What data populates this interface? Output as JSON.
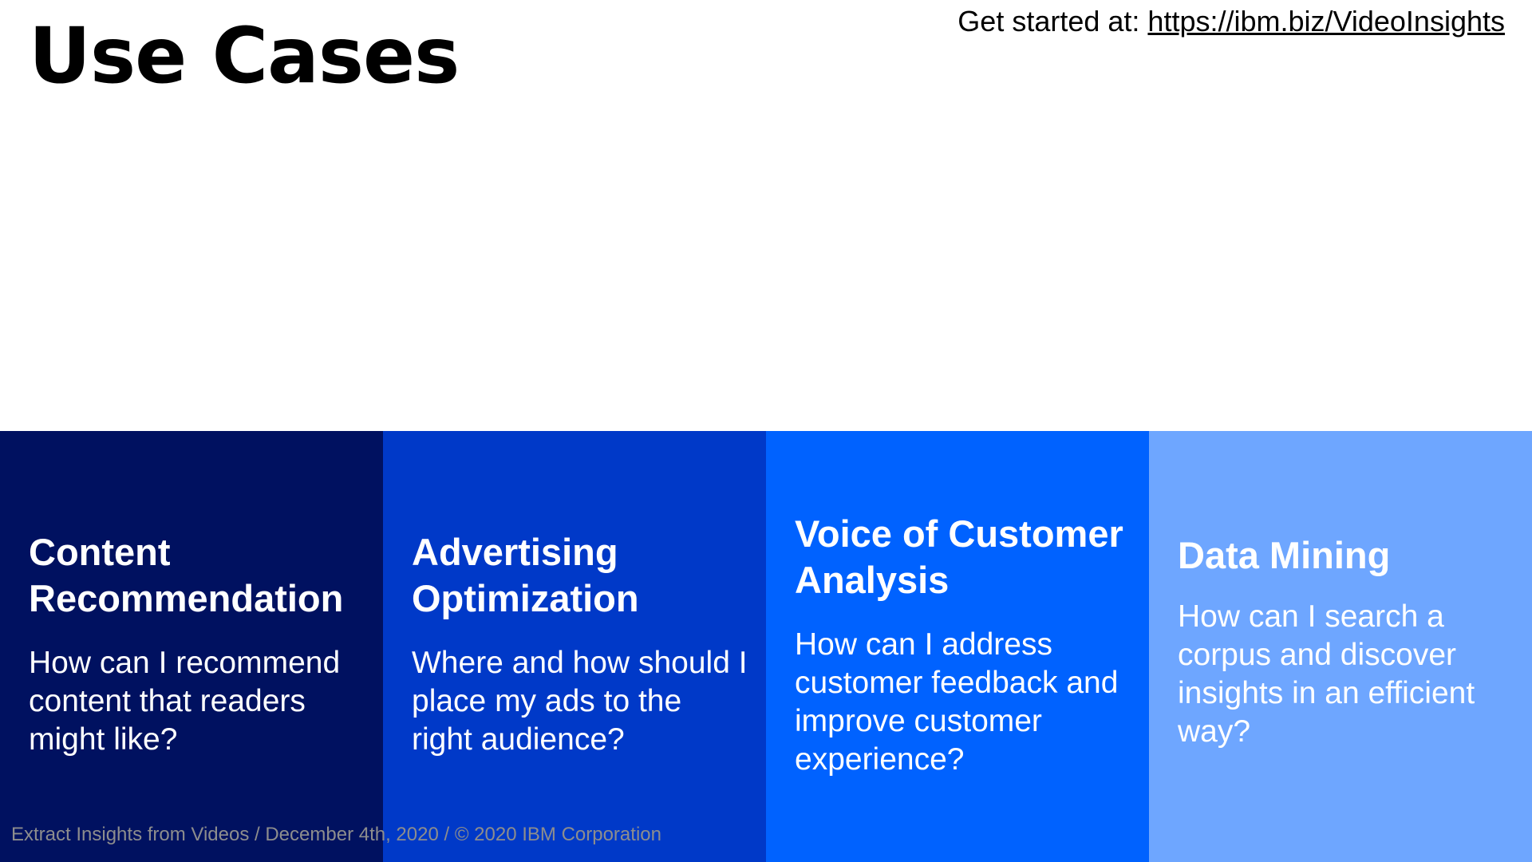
{
  "header": {
    "title": "Use Cases",
    "link_prefix": "Get started at: ",
    "link_text": "https://ibm.biz/VideoInsights"
  },
  "cards": [
    {
      "title": "Content Recommendation",
      "body": "How can I recommend content that readers might like?",
      "color": "#001160"
    },
    {
      "title": "Advertising Optimization",
      "body": "Where and how should I place my ads to the right audience?",
      "color": "#0039c8"
    },
    {
      "title": "Voice of Customer Analysis",
      "body": "How can I address customer feedback and improve customer experience?",
      "color": "#0062ff"
    },
    {
      "title": "Data Mining",
      "body": "How can I search a corpus and discover insights in an efficient way?",
      "color": "#6ea6ff"
    }
  ],
  "footer": {
    "text": "Extract Insights from Videos / December 4th, 2020 / © 2020 IBM Corporation"
  }
}
